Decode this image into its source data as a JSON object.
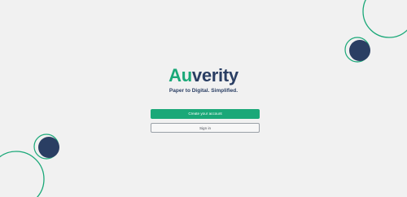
{
  "brand": {
    "name_accent": "Au",
    "name_rest": "verity",
    "tagline": "Paper to Digital. Simplified.",
    "accent_color": "#1aa878",
    "primary_color": "#2a3e63"
  },
  "actions": {
    "create_account_label": "Create your account",
    "sign_in_label": "Sign in"
  },
  "decoration": {
    "icons": [
      "circle-outline-icon",
      "filled-circle-icon"
    ]
  }
}
